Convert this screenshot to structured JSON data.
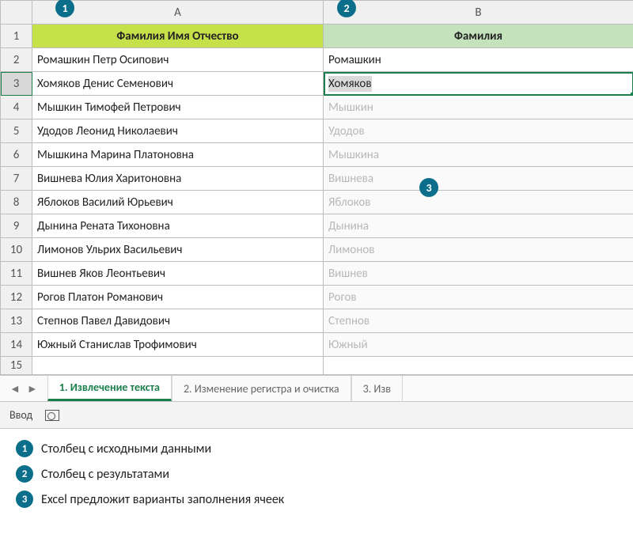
{
  "columns": {
    "A": "A",
    "B": "B"
  },
  "rowNumbers": [
    "1",
    "2",
    "3",
    "4",
    "5",
    "6",
    "7",
    "8",
    "9",
    "10",
    "11",
    "12",
    "13",
    "14",
    "15"
  ],
  "headers": {
    "A": "Фамилия Имя Отчество",
    "B": "Фамилия"
  },
  "rows": [
    {
      "a": "Ромашкин Петр Осипович",
      "b": "Ромашкин",
      "state": "normal"
    },
    {
      "a": "Хомяков Денис Семенович",
      "b": "Хомяков",
      "state": "selected"
    },
    {
      "a": "Мышкин Тимофей Петрович",
      "b": "Мышкин",
      "state": "suggest"
    },
    {
      "a": "Удодов Леонид Николаевич",
      "b": "Удодов",
      "state": "suggest"
    },
    {
      "a": "Мышкина Марина Платоновна",
      "b": "Мышкина",
      "state": "suggest"
    },
    {
      "a": "Вишнева Юлия Харитоновна",
      "b": "Вишнева",
      "state": "suggest"
    },
    {
      "a": "Яблоков Василий Юрьевич",
      "b": "Яблоков",
      "state": "suggest"
    },
    {
      "a": "Дынина Рената Тихоновна",
      "b": "Дынина",
      "state": "suggest"
    },
    {
      "a": "Лимонов Ульрих Васильевич",
      "b": "Лимонов",
      "state": "suggest"
    },
    {
      "a": "Вишнев Яков Леонтьевич",
      "b": "Вишнев",
      "state": "suggest"
    },
    {
      "a": "Рогов Платон Романович",
      "b": "Рогов",
      "state": "suggest"
    },
    {
      "a": "Степнов Павел Давидович",
      "b": "Степнов",
      "state": "suggest"
    },
    {
      "a": "Южный Станислав Трофимович",
      "b": "Южный",
      "state": "suggest"
    }
  ],
  "tabs": {
    "active": "1. Извлечение текста",
    "second": "2. Изменение регистра и очистка",
    "third": "3. Изв"
  },
  "statusbar": {
    "mode": "Ввод"
  },
  "callouts": {
    "c1": "1",
    "c2": "2",
    "c3": "3"
  },
  "legend": {
    "l1": "Столбец с исходными данными",
    "l2": "Столбец с результатами",
    "l3": "Excel предложит варианты заполнения ячеек"
  },
  "colors": {
    "accent": "#1a7f4d",
    "callout": "#0b6f8b",
    "headerA": "#c6e04a",
    "headerB": "#c4e3bd"
  }
}
